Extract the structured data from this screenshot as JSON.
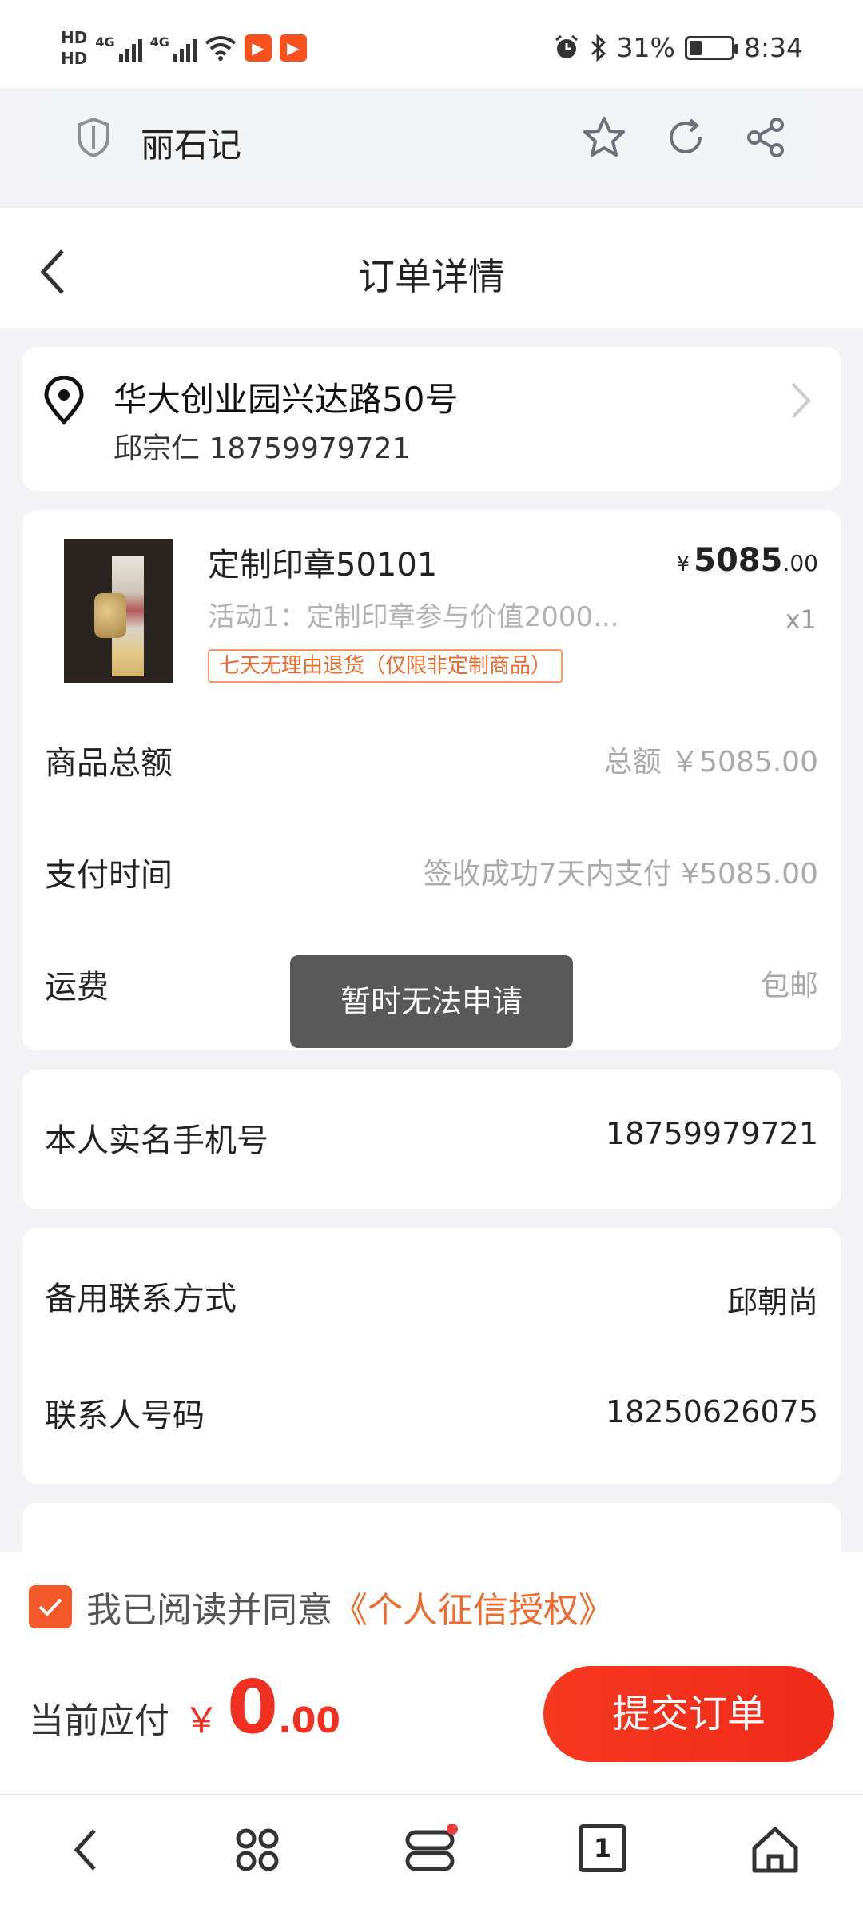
{
  "status_bar": {
    "hd1": "HD",
    "hd2": "HD",
    "net1": "4G",
    "net2": "4G",
    "battery_pct": "31%",
    "battery_level": 0.31,
    "time": "8:34",
    "icons": [
      "signal-icon",
      "wifi-icon",
      "app-notification-icon",
      "alarm-icon",
      "bluetooth-icon",
      "battery-icon"
    ]
  },
  "browser": {
    "site_name": "丽石记",
    "icons": [
      "shield-icon",
      "star-icon",
      "refresh-icon",
      "share-icon"
    ]
  },
  "header": {
    "title": "订单详情"
  },
  "address": {
    "street": "华大创业园兴达路50号",
    "contact": "邱宗仁 18759979721"
  },
  "product": {
    "name": "定制印章50101",
    "promo": "活动1：定制印章参与价值2000...",
    "tag": "七天无理由退货（仅限非定制商品）",
    "price_currency": "¥",
    "price_int": "5085",
    "price_dec": ".00",
    "qty": "x1"
  },
  "summary": {
    "total_label": "商品总额",
    "total_value": "总额 ￥5085.00",
    "pay_time_label": "支付时间",
    "pay_time_value": "签收成功7天内支付 ¥5085.00",
    "shipping_label": "运费",
    "shipping_value": "包邮"
  },
  "toast": {
    "text": "暂时无法申请"
  },
  "phone": {
    "label": "本人实名手机号",
    "value": "18759979721"
  },
  "backup": {
    "label": "备用联系方式",
    "value": "邱朝尚",
    "number_label": "联系人号码",
    "number_value": "18250626075"
  },
  "bottom": {
    "agree_text": "我已阅读并同意",
    "agree_link": "《个人征信授权》",
    "pay_label": "当前应付",
    "pay_currency": "￥",
    "pay_int": "0",
    "pay_dec": ".00",
    "submit_label": "提交订单"
  },
  "nav": {
    "tab_count": "1",
    "icons": [
      "back-icon",
      "apps-icon",
      "menu-icon",
      "tabs-icon",
      "home-icon"
    ]
  },
  "colors": {
    "accent": "#f03020",
    "orange": "#f06a2e",
    "toast_bg": "#595959"
  }
}
